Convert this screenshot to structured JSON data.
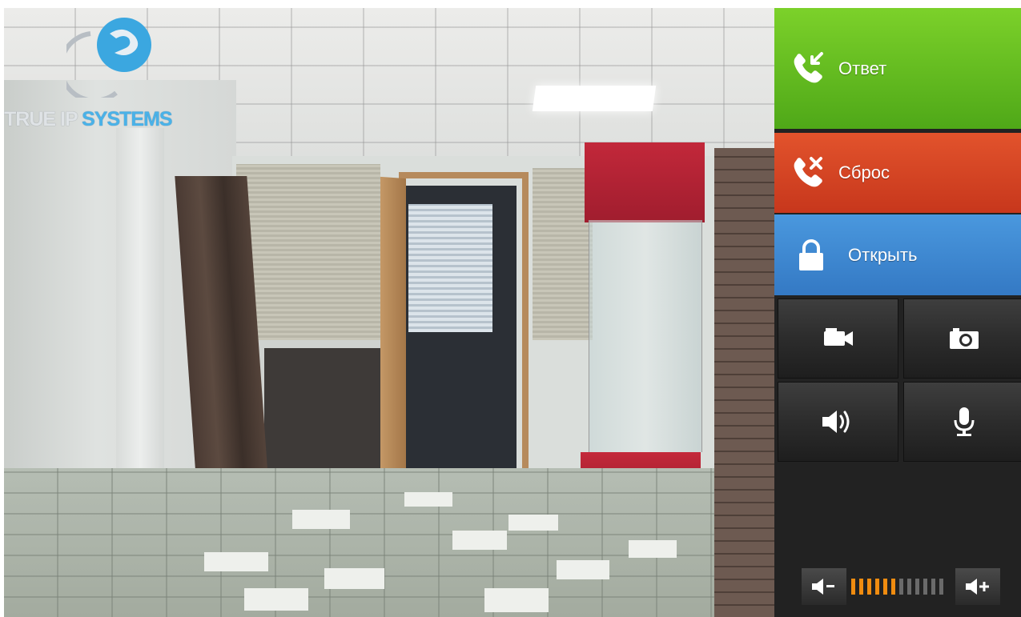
{
  "brand": {
    "word1": "TRUE IP",
    "word2": "SYSTEMS",
    "colors": {
      "word1": "#dfe3e6",
      "word2": "#4ab2e8"
    }
  },
  "camera": {
    "icon": "camera-feed"
  },
  "controls": {
    "answer": {
      "label": "Ответ",
      "icon": "phone-incoming-icon",
      "color": "#5fb81e"
    },
    "reset": {
      "label": "Сброс",
      "icon": "phone-hangup-icon",
      "color": "#d54224"
    },
    "open": {
      "label": "Открыть",
      "icon": "lock-icon",
      "color": "#3d87d0"
    },
    "video": {
      "icon": "video-camera-icon"
    },
    "snapshot": {
      "icon": "camera-icon"
    },
    "speaker": {
      "icon": "speaker-icon"
    },
    "microphone": {
      "icon": "microphone-icon"
    }
  },
  "volume": {
    "level": 6,
    "max": 12,
    "decrease_icon": "volume-down-icon",
    "increase_icon": "volume-up-icon",
    "active_color": "#f08c10"
  }
}
